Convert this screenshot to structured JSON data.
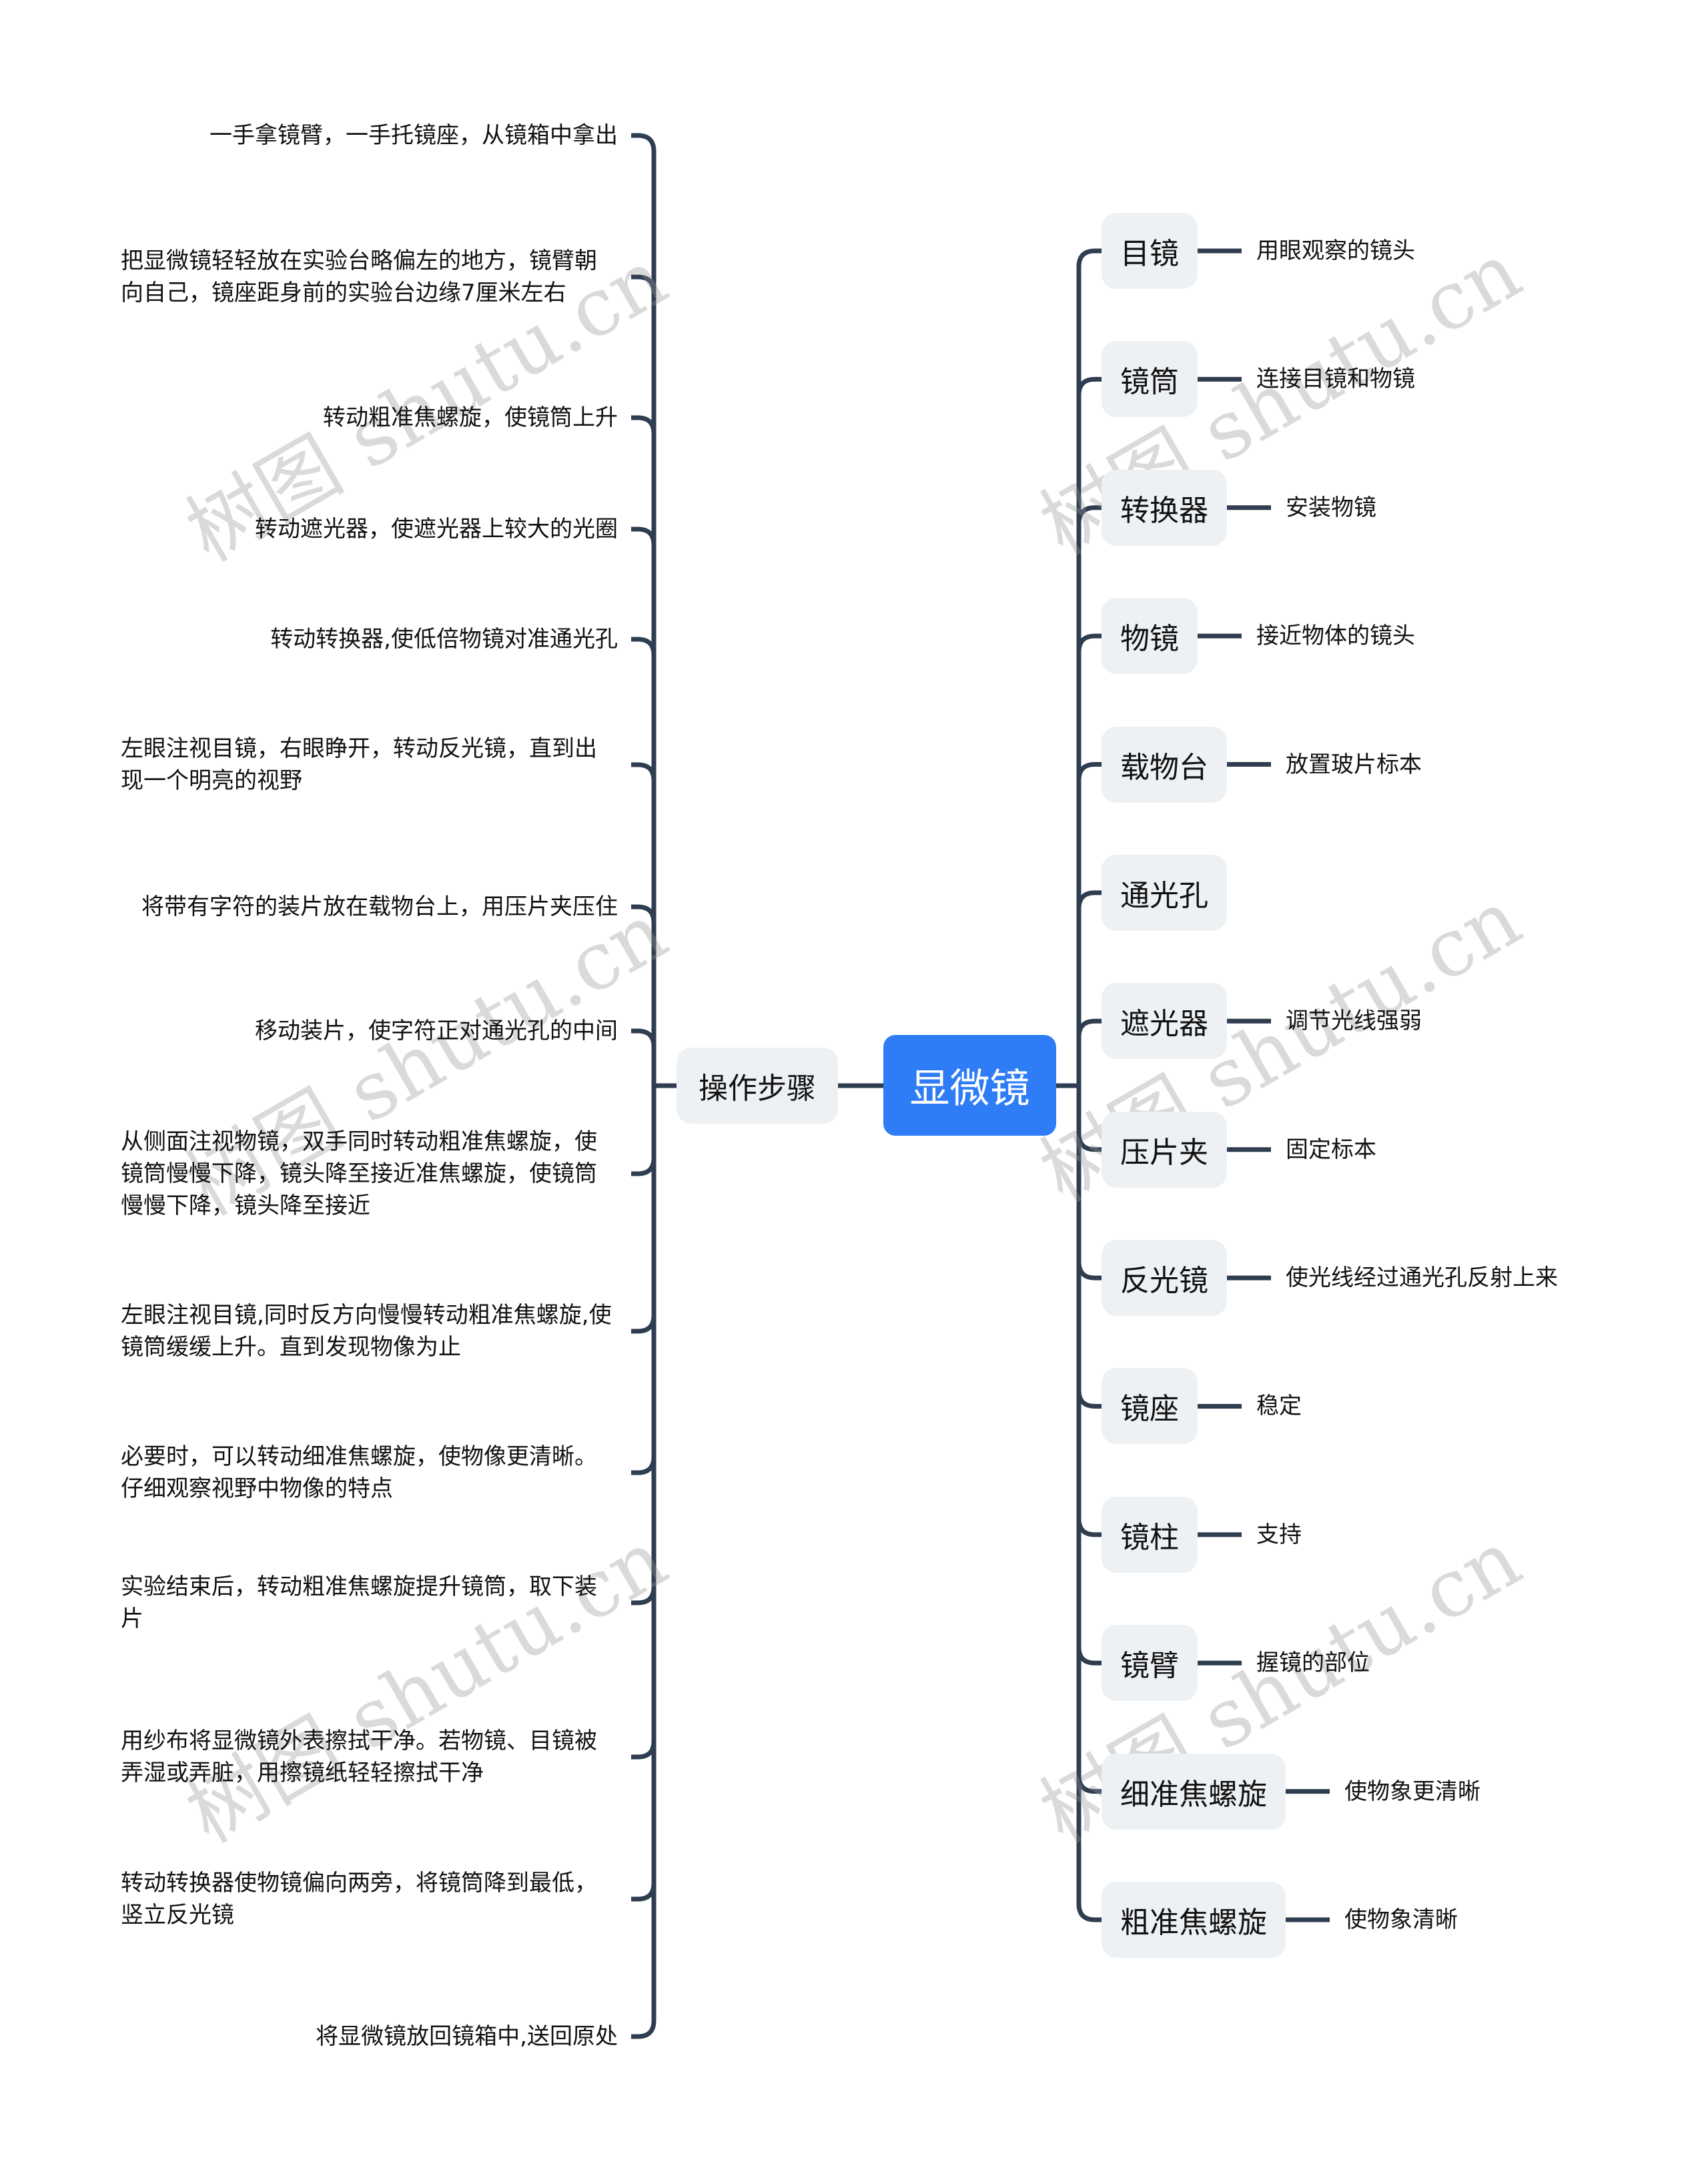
{
  "colors": {
    "root_fill": "#2e7cf6",
    "branch_fill": "#eef1f4",
    "line": "#2f3d50"
  },
  "root": {
    "label": "显微镜"
  },
  "left_branch": {
    "label": "操作步骤",
    "items": [
      "一手拿镜臂，一手托镜座，从镜箱中拿出",
      "把显微镜轻轻放在实验台略偏左的地方，镜臂朝向自己，镜座距身前的实验台边缘7厘米左右",
      "转动粗准焦螺旋，使镜筒上升",
      "转动遮光器，使遮光器上较大的光圈",
      "转动转换器,使低倍物镜对准通光孔",
      "左眼注视目镜，右眼睁开，转动反光镜，直到出现一个明亮的视野",
      "将带有字符的装片放在载物台上，用压片夹压住",
      "移动装片，使字符正对通光孔的中间",
      "从侧面注视物镜，双手同时转动粗准焦螺旋，使镜筒慢慢下降，镜头降至接近准焦螺旋，使镜筒慢慢下降，镜头降至接近",
      "左眼注视目镜,同时反方向慢慢转动粗准焦螺旋,使镜筒缓缓上升。直到发现物像为止",
      "必要时，可以转动细准焦螺旋，使物像更清晰。仔细观察视野中物像的特点",
      "实验结束后，转动粗准焦螺旋提升镜筒，取下装片",
      "用纱布将显微镜外表擦拭干净。若物镜、目镜被弄湿或弄脏，用擦镜纸轻轻擦拭干净",
      "转动转换器使物镜偏向两旁，将镜筒降到最低，竖立反光镜",
      "将显微镜放回镜箱中,送回原处"
    ]
  },
  "right_branches": [
    {
      "label": "目镜",
      "desc": "用眼观察的镜头"
    },
    {
      "label": "镜筒",
      "desc": "连接目镜和物镜"
    },
    {
      "label": "转换器",
      "desc": "安装物镜"
    },
    {
      "label": "物镜",
      "desc": "接近物体的镜头"
    },
    {
      "label": "载物台",
      "desc": "放置玻片标本"
    },
    {
      "label": "通光孔",
      "desc": ""
    },
    {
      "label": "遮光器",
      "desc": "调节光线强弱"
    },
    {
      "label": "压片夹",
      "desc": "固定标本"
    },
    {
      "label": "反光镜",
      "desc": "使光线经过通光孔反射上来"
    },
    {
      "label": "镜座",
      "desc": "稳定"
    },
    {
      "label": "镜柱",
      "desc": "支持"
    },
    {
      "label": "镜臂",
      "desc": "握镜的部位"
    },
    {
      "label": "细准焦螺旋",
      "desc": "使物象更清晰"
    },
    {
      "label": "粗准焦螺旋",
      "desc": "使物象清晰"
    }
  ],
  "watermark": "树图 shutu.cn"
}
